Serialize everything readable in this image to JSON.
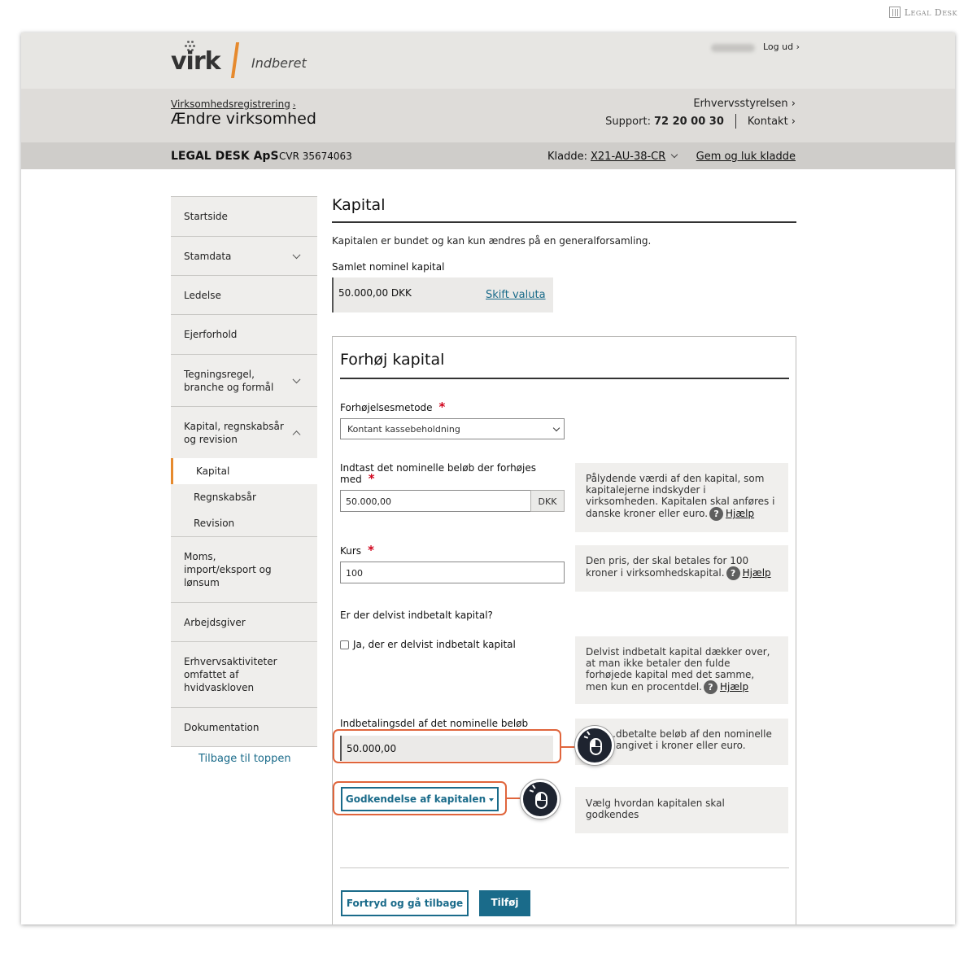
{
  "watermark": {
    "text": "Legal Desk"
  },
  "header": {
    "logo_text": "virk",
    "logo_sub": "Indberet",
    "logout": "Log ud ›"
  },
  "subheader": {
    "breadcrumb": "Virksomhedsregistrering",
    "title": "Ændre virksomhed",
    "agency": "Erhvervsstyrelsen ›",
    "support_label": "Support:",
    "support_phone": "72 20 00 30",
    "contact": "Kontakt ›"
  },
  "companybar": {
    "company": "LEGAL DESK ApS",
    "cvr": "CVR 35674063",
    "kladde_label": "Kladde:",
    "kladde_value": "X21-AU-38-CR",
    "save_close": "Gem og luk kladde"
  },
  "sidenav": {
    "items": [
      {
        "label": "Startside"
      },
      {
        "label": "Stamdata"
      },
      {
        "label": "Ledelse"
      },
      {
        "label": "Ejerforhold"
      },
      {
        "label": "Tegningsregel, branche og formål"
      },
      {
        "label": "Kapital, regnskabsår og revision"
      },
      {
        "label": "Moms, import/eksport og lønsum"
      },
      {
        "label": "Arbejdsgiver"
      },
      {
        "label": "Erhvervsaktiviteter omfattet af hvidvaskloven"
      },
      {
        "label": "Dokumentation"
      }
    ],
    "sub_items": [
      {
        "label": "Kapital"
      },
      {
        "label": "Regnskabsår"
      },
      {
        "label": "Revision"
      }
    ],
    "back_to_top": "Tilbage til toppen"
  },
  "main": {
    "title": "Kapital",
    "intro": "Kapitalen er bundet og kan kun ændres på en generalforsamling.",
    "total_label": "Samlet nominel kapital",
    "total_value": "50.000,00 DKK",
    "change_currency": "Skift valuta"
  },
  "form": {
    "title": "Forhøj kapital",
    "method_label": "Forhøjelsesmetode",
    "method_value": "Kontant kassebeholdning",
    "nominal_label": "Indtast det nominelle beløb der forhøjes med",
    "nominal_value": "50.000,00",
    "currency": "DKK",
    "nominal_help": "Pålydende værdi af den kapital, som kapitalejerne indskyder i virksomheden. Kapitalen skal anføres i danske kroner eller euro.",
    "kurs_label": "Kurs",
    "kurs_value": "100",
    "kurs_help": "Den pris, der skal betales for 100 kroner i virksomhedskapital.",
    "partial_question": "Er der delvist indbetalt kapital?",
    "partial_checkbox": "Ja, der er delvist indbetalt kapital",
    "partial_help": "Delvist indbetalt kapital dækker over, at man ikke betaler den fulde forhøjede kapital med det samme, men kun en procentdel.",
    "paid_label": "Indbetalingsdel af det nominelle beløb",
    "paid_value": "50.000,00",
    "paid_help": "…dbetalte beløb af den nominelle …angivet i kroner eller euro.",
    "approval_button": "Godkendelse af kapitalen",
    "approval_help": "Vælg hvordan kapitalen skal godkendes",
    "help_link": "Hjælp",
    "help_q": "?",
    "cancel_button": "Fortryd og gå tilbage",
    "add_button": "Tilføj",
    "required_mark": "*"
  },
  "colors": {
    "accent": "#1a6b8a",
    "orange": "#e68a2e",
    "required": "#d0021b",
    "highlight": "#e0653c"
  }
}
